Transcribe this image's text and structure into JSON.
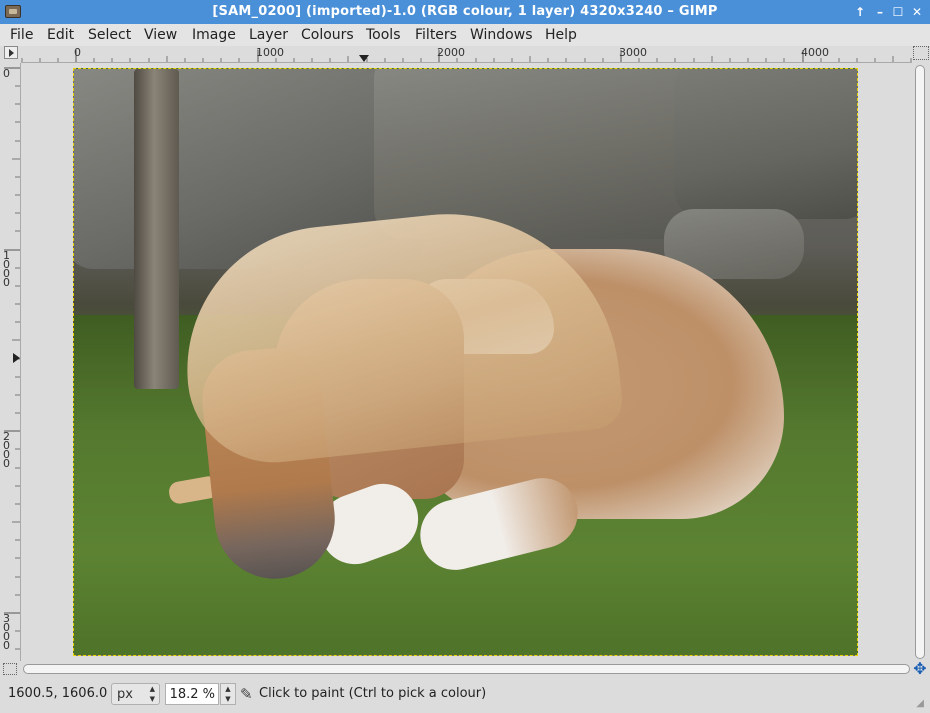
{
  "window": {
    "title": "[SAM_0200] (imported)-1.0 (RGB colour, 1 layer) 4320x3240 – GIMP",
    "app_icon": "gimp-icon",
    "controls": {
      "up": "↑",
      "minimize": "–",
      "maximize": "☐",
      "close": "✕"
    }
  },
  "menubar": {
    "items": [
      "File",
      "Edit",
      "Select",
      "View",
      "Image",
      "Layer",
      "Colours",
      "Tools",
      "Filters",
      "Windows",
      "Help"
    ]
  },
  "hruler": {
    "labels": [
      "0",
      "1000",
      "2000",
      "3000",
      "4000"
    ]
  },
  "vruler": {
    "labels": [
      "0",
      "1000",
      "2000",
      "3000"
    ]
  },
  "canvas": {
    "image_description_icon": "pony-photo"
  },
  "status": {
    "pointer_coords": "1600.5, 1606.0",
    "unit": "px",
    "zoom": "18.2 %",
    "tool_icon": "paintbrush-icon",
    "message": "Click to paint (Ctrl to pick a colour)"
  }
}
